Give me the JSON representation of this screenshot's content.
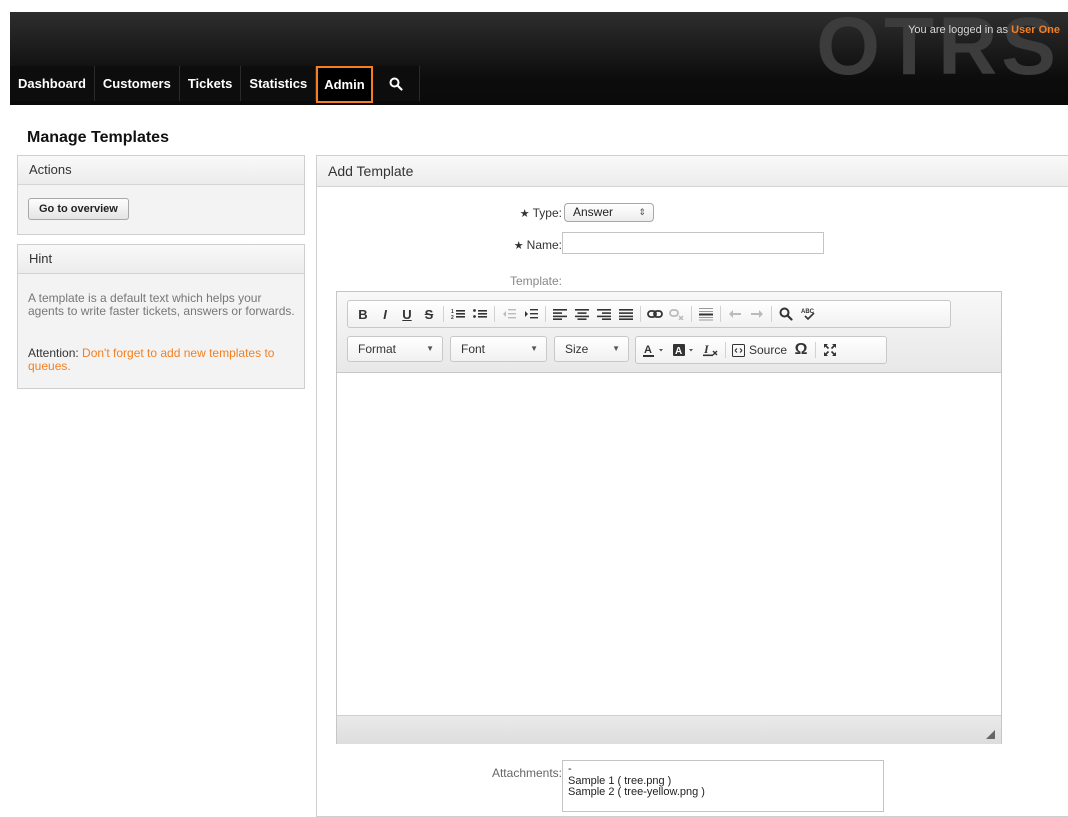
{
  "header": {
    "logo": "OTRS",
    "login_prefix": "You are logged in as",
    "user_name": "User One",
    "nav": [
      {
        "label": "Dashboard"
      },
      {
        "label": "Customers"
      },
      {
        "label": "Tickets"
      },
      {
        "label": "Statistics"
      },
      {
        "label": "Admin",
        "active": true
      },
      {
        "icon": "search-icon"
      }
    ]
  },
  "page": {
    "title": "Manage Templates"
  },
  "sidebar": {
    "actions": {
      "title": "Actions",
      "button": "Go to overview"
    },
    "hint": {
      "title": "Hint",
      "text": "A template is a default text which helps your agents to write faster tickets, answers or forwards.",
      "attention_label": "Attention:",
      "attention_text": "Don't forget to add new templates to queues."
    }
  },
  "main": {
    "title": "Add Template",
    "type_label": "Type:",
    "type_value": "Answer",
    "name_label": "Name:",
    "name_value": "",
    "template_label": "Template:",
    "attachments_label": "Attachments:",
    "attachments": [
      "-",
      "Sample 1 ( tree.png )",
      "Sample 2 ( tree-yellow.png )"
    ]
  },
  "editor": {
    "toolbar_row1": [
      "B",
      "I",
      "U",
      "S",
      "numbered-list",
      "bulleted-list",
      "outdent",
      "indent",
      "align-left",
      "align-center",
      "align-right",
      "justify",
      "link",
      "unlink",
      "horizontal-rule",
      "undo",
      "redo",
      "find",
      "spellcheck"
    ],
    "format_label": "Format",
    "font_label": "Font",
    "size_label": "Size",
    "source_label": "Source"
  },
  "colors": {
    "accent": "#f57f20",
    "header_bg": "#111111"
  }
}
